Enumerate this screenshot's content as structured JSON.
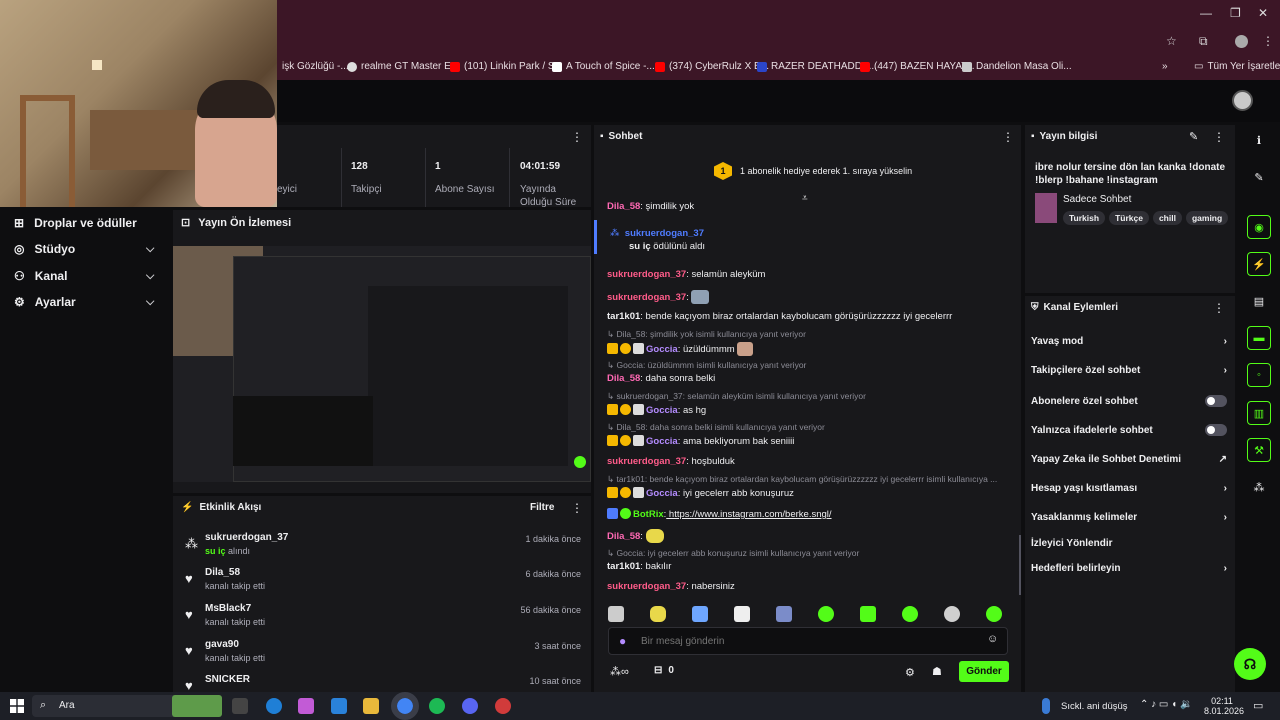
{
  "browser": {
    "bookmarks": [
      {
        "label": "işk Gözlüğü -...",
        "icon": "page-icon"
      },
      {
        "label": "realme GT Master E...",
        "icon": "globe-icon"
      },
      {
        "label": "(101) Linkin Park / S...",
        "icon": "youtube-icon"
      },
      {
        "label": "A Touch of Spice -...",
        "icon": "page-icon"
      },
      {
        "label": "(374) CyberRulz X B...",
        "icon": "youtube-icon"
      },
      {
        "label": "RAZER DEATHADDE...",
        "icon": "v-icon"
      },
      {
        "label": "(447) BAZEN HAYAT...",
        "icon": "youtube-icon"
      },
      {
        "label": "Dandelion Masa Oli...",
        "icon": "page-icon"
      }
    ],
    "more": "»",
    "all_bookmarks": "Tüm Yer İşaretleri"
  },
  "left_nav": {
    "items": [
      {
        "label": "Droplar ve ödüller",
        "icon": "drops-icon",
        "chevron": false
      },
      {
        "label": "Stüdyo",
        "icon": "studio-icon",
        "chevron": true
      },
      {
        "label": "Kanal",
        "icon": "channel-icon",
        "chevron": true
      },
      {
        "label": "Ayarlar",
        "icon": "gear-icon",
        "chevron": true
      }
    ]
  },
  "stats": {
    "items": [
      {
        "value": "",
        "label": "eyici"
      },
      {
        "value": "128",
        "label": "Takipçi"
      },
      {
        "value": "1",
        "label": "Abone Sayısı"
      },
      {
        "value": "04:01:59",
        "label": "Yayında Olduğu Süre"
      }
    ]
  },
  "preview": {
    "title": "Yayın Ön İzlemesi"
  },
  "activity": {
    "title": "Etkinlik Akışı",
    "filter": "Filtre",
    "items": [
      {
        "name": "sukruerdogan_37",
        "sub_highlight": "su iç",
        "sub": "alındı",
        "time": "1 dakika önce",
        "icon": "gift-icon"
      },
      {
        "name": "Dila_58",
        "sub_highlight": "",
        "sub": "kanalı takip etti",
        "time": "6 dakika önce",
        "icon": "heart-icon"
      },
      {
        "name": "MsBlack7",
        "sub_highlight": "",
        "sub": "kanalı takip etti",
        "time": "56 dakika önce",
        "icon": "heart-icon"
      },
      {
        "name": "gava90",
        "sub_highlight": "",
        "sub": "kanalı takip etti",
        "time": "3 saat önce",
        "icon": "heart-icon"
      },
      {
        "name": "SNICKER",
        "sub_highlight": "",
        "sub": "",
        "time": "10 saat önce",
        "icon": "heart-icon"
      }
    ]
  },
  "chat": {
    "title": "Sohbet",
    "pinned": "1 abonelik hediye ederek 1. sıraya yükselin",
    "pinned_rank": "1",
    "lines": [
      {
        "user": "Dila_58",
        "color": "#ff69b4",
        "text": " şimdilik yok",
        "reply": ""
      },
      {
        "user": "sukruerdogan_37",
        "color": "#4f7cff",
        "text": "",
        "reply": "",
        "reward": "su iç",
        "reward_text": " ödülünü aldı"
      },
      {
        "user": "sukruerdogan_37",
        "color": "#ff5c8a",
        "text": " selamün aleyküm",
        "reply": ""
      },
      {
        "user": "sukruerdogan_37",
        "color": "#ff5c8a",
        "text": "",
        "reply": ""
      },
      {
        "user": "tar1k01",
        "color": "#efeff1",
        "text": " bende kaçıyom biraz ortalardan kaybolucam görüşürüzzzzzz iyi gecelerrr",
        "reply": ""
      },
      {
        "user": "Goccia",
        "color": "#b48cff",
        "text": " üzüldümmm",
        "reply": "Dila_58: şimdilik yok isimli kullanıcıya yanıt veriyor"
      },
      {
        "user": "Dila_58",
        "color": "#ff69b4",
        "text": " daha sonra belki",
        "reply": "Goccia: üzüldümmm isimli kullanıcıya yanıt veriyor"
      },
      {
        "user": "Goccia",
        "color": "#b48cff",
        "text": " as hg",
        "reply": "sukruerdogan_37: selamün aleyküm isimli kullanıcıya yanıt veriyor"
      },
      {
        "user": "Goccia",
        "color": "#b48cff",
        "text": " ama bekliyorum bak seniiii",
        "reply": "Dila_58: daha sonra belki isimli kullanıcıya yanıt veriyor"
      },
      {
        "user": "sukruerdogan_37",
        "color": "#ff5c8a",
        "text": " hoşbulduk",
        "reply": ""
      },
      {
        "user": "Goccia",
        "color": "#b48cff",
        "text": " iyi gecelerr abb konuşuruz",
        "reply": "tar1k01: bende kaçıyom biraz ortalardan kaybolucam görüşürüzzzzzz iyi gecelerrr isimli kullanıcıya ..."
      },
      {
        "user": "BotRix",
        "color": "#53fc18",
        "text": " https://www.instagram.com/berke.sngl/",
        "reply": ""
      },
      {
        "user": "Dila_58",
        "color": "#ff69b4",
        "text": "",
        "reply": ""
      },
      {
        "user": "tar1k01",
        "color": "#efeff1",
        "text": " bakılır",
        "reply": "Goccia: iyi gecelerr abb konuşuruz isimli kullanıcıya yanıt veriyor"
      },
      {
        "user": "sukruerdogan_37",
        "color": "#ff5c8a",
        "text": " nabersiniz",
        "reply": ""
      }
    ],
    "input_placeholder": "Bir mesaj gönderin",
    "send": "Gönder",
    "points": "0"
  },
  "info": {
    "title": "Yayın bilgisi",
    "stream_title": "ibre nolur tersine dön lan kanka !donate !blerp !bahane !instagram",
    "category": "Sadece Sohbet",
    "tags": [
      "Turkish",
      "Türkçe",
      "chill",
      "gaming"
    ]
  },
  "actions": {
    "title": "Kanal Eylemleri",
    "items": [
      {
        "label": "Yavaş mod",
        "control": "chevron"
      },
      {
        "label": "Takipçilere özel sohbet",
        "control": "chevron"
      },
      {
        "label": "Abonelere özel sohbet",
        "control": "toggle"
      },
      {
        "label": "Yalnızca ifadelerle sohbet",
        "control": "toggle"
      },
      {
        "label": "Yapay Zeka ile Sohbet Denetimi",
        "control": "external"
      },
      {
        "label": "Hesap yaşı kısıtlaması",
        "control": "chevron"
      },
      {
        "label": "Yasaklanmış kelimeler",
        "control": "chevron"
      },
      {
        "label": "İzleyici Yönlendir",
        "control": "none"
      },
      {
        "label": "Hedefleri belirleyin",
        "control": "chevron"
      }
    ]
  },
  "taskbar": {
    "search": "Ara",
    "weather": "Sıckl. ani düşüş",
    "time": "02:11",
    "date": "8.01.2026"
  },
  "colors": {
    "accent": "#53fc18",
    "panel": "#18181b",
    "bg": "#0e0e10",
    "chrome": "#3c1626"
  }
}
